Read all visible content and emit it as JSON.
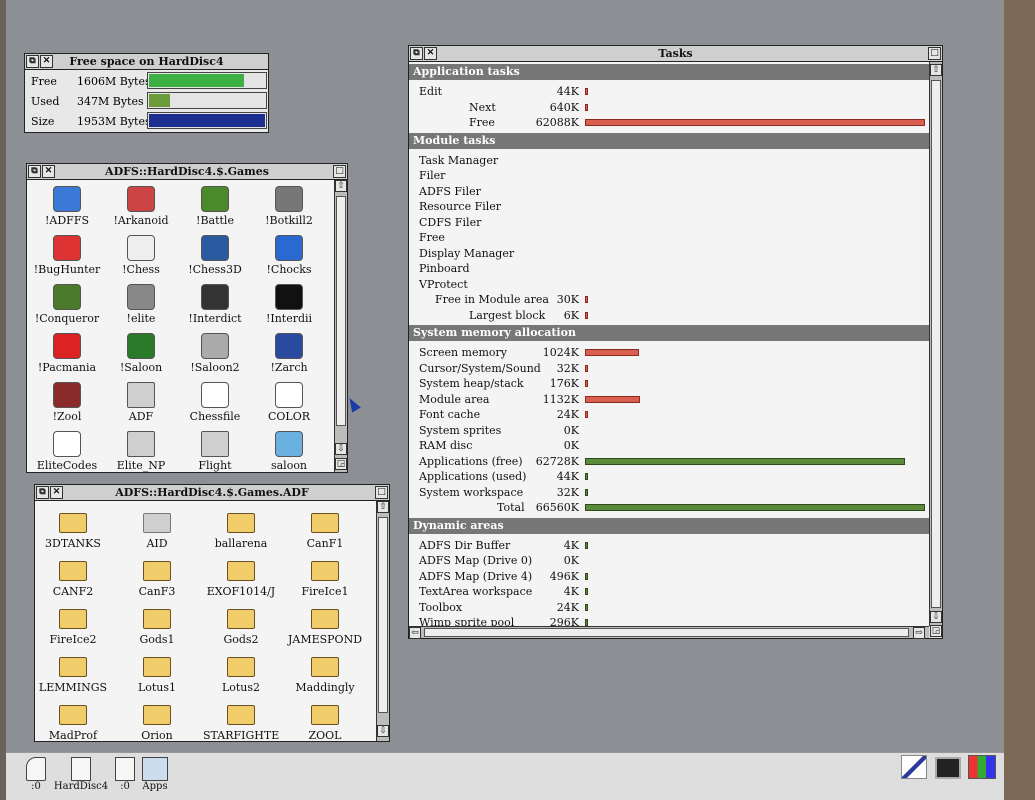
{
  "colors": {
    "desktop": "#8c9094",
    "window_bg": "#f4f4f4",
    "task_bar_red": "#d96050",
    "task_bar_green": "#5a8a3a",
    "free_green": "#3cb043",
    "used_green": "#6a9a3a",
    "size_blue": "#1c2f8f"
  },
  "free_space": {
    "title": "Free space on HardDisc4",
    "rows": [
      {
        "label": "Free",
        "value": "1606M Bytes",
        "fraction": 0.82
      },
      {
        "label": "Used",
        "value": "347M Bytes",
        "fraction": 0.18
      },
      {
        "label": "Size",
        "value": "1953M Bytes",
        "fraction": 1.0
      }
    ]
  },
  "games_window": {
    "title": "ADFS::HardDisc4.$.Games",
    "items": [
      {
        "name": "!ADFFS",
        "icon": "adffs-icon"
      },
      {
        "name": "!Arkanoid",
        "icon": "arkanoid-icon"
      },
      {
        "name": "!Battle",
        "icon": "battle-icon"
      },
      {
        "name": "!Botkill2",
        "icon": "botkill-icon"
      },
      {
        "name": "!BugHunter",
        "icon": "bughunter-icon"
      },
      {
        "name": "!Chess",
        "icon": "chess-icon"
      },
      {
        "name": "!Chess3D",
        "icon": "chess3d-icon"
      },
      {
        "name": "!Chocks",
        "icon": "chocks-icon"
      },
      {
        "name": "!Conqueror",
        "icon": "tank-icon"
      },
      {
        "name": "!elite",
        "icon": "elite-icon"
      },
      {
        "name": "!Interdict",
        "icon": "interdict-icon"
      },
      {
        "name": "!Interdii",
        "icon": "jet-icon"
      },
      {
        "name": "!Pacmania",
        "icon": "ghost-icon"
      },
      {
        "name": "!Saloon",
        "icon": "saloon-icon"
      },
      {
        "name": "!Saloon2",
        "icon": "saloon2-icon"
      },
      {
        "name": "!Zarch",
        "icon": "zarch-icon"
      },
      {
        "name": "!Zool",
        "icon": "zool-icon"
      },
      {
        "name": "ADF",
        "icon": "folder-grey-icon"
      },
      {
        "name": "Chessfile",
        "icon": "chessfile-icon"
      },
      {
        "name": "COLOR",
        "icon": "document-icon"
      },
      {
        "name": "EliteCodes",
        "icon": "document-icon"
      },
      {
        "name": "Elite_NP",
        "icon": "folder-grey-icon"
      },
      {
        "name": "Flight",
        "icon": "folder-grey-icon"
      },
      {
        "name": "saloon",
        "icon": "sprite-file-icon"
      }
    ]
  },
  "adf_window": {
    "title": "ADFS::HardDisc4.$.Games.ADF",
    "items": [
      "3DTANKS",
      "AID",
      "ballarena",
      "CanF1",
      "CANF2",
      "CanF3",
      "EXOF1014/J",
      "FireIce1",
      "FireIce2",
      "Gods1",
      "Gods2",
      "JAMESPOND",
      "LEMMINGS",
      "Lotus1",
      "Lotus2",
      "Maddingly",
      "MadProf",
      "Orion",
      "STARFIGHTE",
      "ZOOL"
    ],
    "grey_items": [
      "AID"
    ]
  },
  "tasks": {
    "title": "Tasks",
    "sections": [
      {
        "heading": "Application tasks",
        "rows": [
          {
            "name": "Edit",
            "value": "44K",
            "kb": 44,
            "indent": 0
          },
          {
            "name": "Next",
            "value": "640K",
            "kb": 640,
            "indent": 2
          },
          {
            "name": "Free",
            "value": "62088K",
            "kb": 62088,
            "indent": 2
          }
        ]
      },
      {
        "heading": "Module tasks",
        "rows": [
          {
            "name": "Task Manager"
          },
          {
            "name": "Filer"
          },
          {
            "name": "ADFS Filer"
          },
          {
            "name": "Resource Filer"
          },
          {
            "name": "CDFS Filer"
          },
          {
            "name": "Free"
          },
          {
            "name": "Display Manager"
          },
          {
            "name": "Pinboard"
          },
          {
            "name": "VProtect"
          },
          {
            "name": "Free in Module area",
            "value": "30K",
            "kb": 30,
            "indent": 1
          },
          {
            "name": "Largest block",
            "value": "6K",
            "kb": 6,
            "indent": 2
          }
        ]
      },
      {
        "heading": "System memory allocation",
        "rows": [
          {
            "name": "Screen memory",
            "value": "1024K",
            "kb": 1024
          },
          {
            "name": "Cursor/System/Sound",
            "value": "32K",
            "kb": 32
          },
          {
            "name": "System heap/stack",
            "value": "176K",
            "kb": 176
          },
          {
            "name": "Module area",
            "value": "1132K",
            "kb": 1132
          },
          {
            "name": "Font cache",
            "value": "24K",
            "kb": 24
          },
          {
            "name": "System sprites",
            "value": "0K",
            "kb": 0
          },
          {
            "name": "RAM disc",
            "value": "0K",
            "kb": 0
          },
          {
            "name": "Applications (free)",
            "value": "62728K",
            "kb": 62728,
            "green": true
          },
          {
            "name": "Applications (used)",
            "value": "44K",
            "kb": 44,
            "green": true
          },
          {
            "name": "System workspace",
            "value": "32K",
            "kb": 32,
            "green": true
          },
          {
            "name": "Total",
            "value": "66560K",
            "kb": 66560,
            "green": true,
            "indent": 2
          }
        ]
      },
      {
        "heading": "Dynamic areas",
        "rows": [
          {
            "name": "ADFS Dir Buffer",
            "value": "4K",
            "kb": 4,
            "green": true
          },
          {
            "name": "ADFS Map (Drive 0)",
            "value": "0K",
            "kb": 0,
            "green": true
          },
          {
            "name": "ADFS Map (Drive 4)",
            "value": "496K",
            "kb": 496,
            "green": true
          },
          {
            "name": "TextArea workspace",
            "value": "4K",
            "kb": 4,
            "green": true
          },
          {
            "name": "Toolbox",
            "value": "24K",
            "kb": 24,
            "green": true
          },
          {
            "name": "Wimp sprite pool",
            "value": "296K",
            "kb": 296,
            "green": true
          }
        ]
      }
    ]
  },
  "iconbar": {
    "items": [
      {
        "label": ":0",
        "icon": "floppy-drive-icon"
      },
      {
        "label": "HardDisc4",
        "icon": "hard-disc-icon"
      },
      {
        "label": ":0",
        "icon": "ram-disc-icon"
      },
      {
        "label": "Apps",
        "icon": "apps-icon"
      }
    ],
    "right_icons": [
      "edit-icon",
      "display-icon",
      "task-manager-icon"
    ]
  }
}
